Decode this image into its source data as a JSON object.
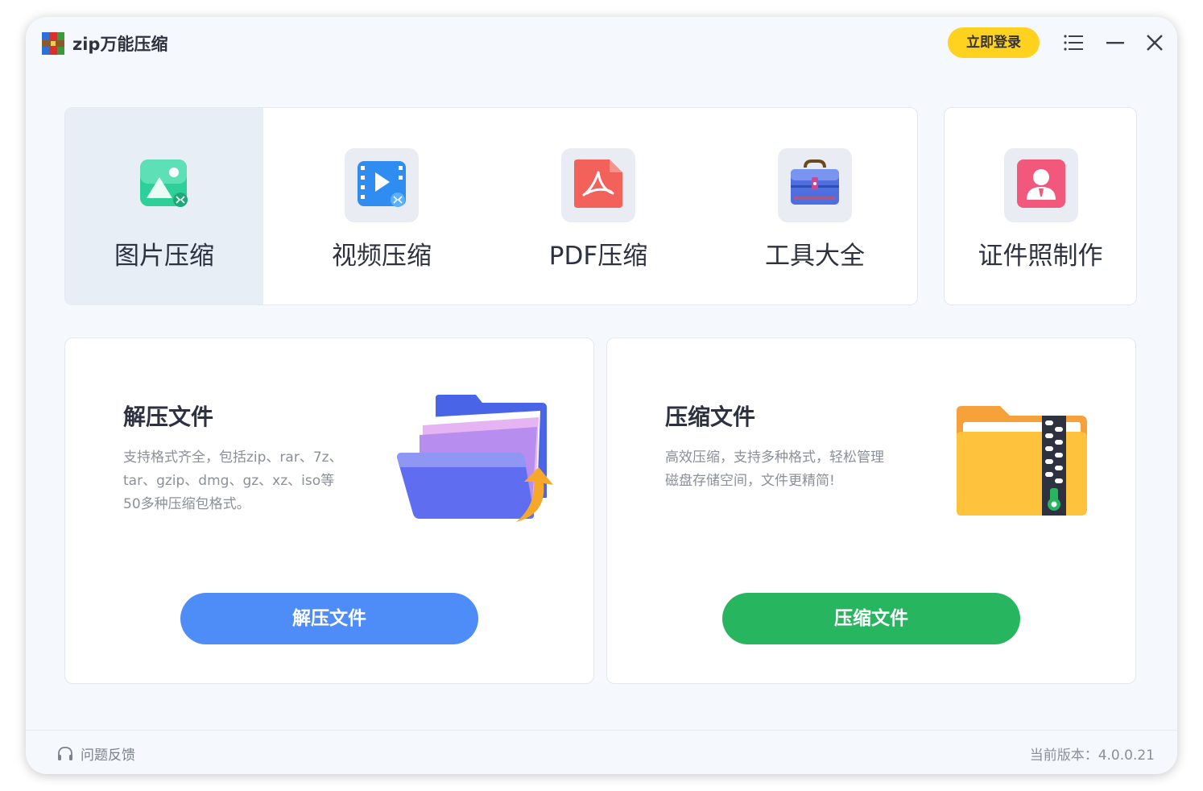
{
  "app": {
    "title": "zip万能压缩",
    "login_label": "立即登录"
  },
  "tools": [
    {
      "label": "图片压缩",
      "icon": "image-compress-icon",
      "active": true
    },
    {
      "label": "视频压缩",
      "icon": "video-compress-icon"
    },
    {
      "label": "PDF压缩",
      "icon": "pdf-compress-icon"
    },
    {
      "label": "工具大全",
      "icon": "toolbox-icon"
    }
  ],
  "id_photo": {
    "label": "证件照制作",
    "icon": "id-photo-icon"
  },
  "extract": {
    "title": "解压文件",
    "desc_lines": [
      "支持格式齐全，包括zip、rar、7z、",
      "tar、gzip、dmg、gz、xz、iso等",
      "50多种压缩包格式。"
    ],
    "button": "解压文件"
  },
  "compress": {
    "title": "压缩文件",
    "desc_lines": [
      "高效压缩，支持多种格式，轻松管理",
      "磁盘存储空间，文件更精简!"
    ],
    "button": "压缩文件"
  },
  "footer": {
    "feedback": "问题反馈",
    "version": "当前版本：4.0.0.21"
  },
  "colors": {
    "login": "#ffd21f",
    "extract_button": "#4e8cf7",
    "compress_button": "#27b55f"
  }
}
